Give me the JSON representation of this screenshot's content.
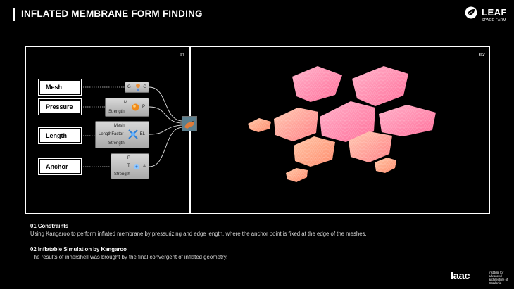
{
  "header": {
    "title": "INFLATED MEMBRANE FORM FINDING"
  },
  "logo": {
    "name": "LEAF",
    "sub": "SPACE FARM",
    "icon": "leaf-icon"
  },
  "panels": {
    "left_number": "01",
    "right_number": "02"
  },
  "grasshopper": {
    "params": [
      {
        "label": "Mesh"
      },
      {
        "label": "Pressure"
      },
      {
        "label": "Length"
      },
      {
        "label": "Anchor"
      }
    ],
    "components": {
      "mesh": {
        "in": "G",
        "out": "G"
      },
      "pressure": {
        "in1": "M",
        "in2": "Strength",
        "out": "P"
      },
      "length": {
        "in1": "Mesh",
        "in2": "LengthFactor",
        "in3": "Strength",
        "out": "EL"
      },
      "anchor": {
        "in1": "P",
        "in2": "T",
        "in3": "Strength",
        "out": "A"
      }
    },
    "solver_icon": "kangaroo-icon"
  },
  "captions": [
    {
      "heading": "01 Constraints",
      "body": "Using Kangaroo to perform inflated membrane by pressurizing and edge length, where the anchor point is fixed at the edge of the meshes."
    },
    {
      "heading": "02 Inflatable Simulation by Kangaroo",
      "body": "The results of innershell was brought by the final convergent of inflated geometry."
    }
  ],
  "footer": {
    "logo_text": "Iaac",
    "logo_sub": "Institute for advanced architecture of Catalonia"
  },
  "colors": {
    "background": "#000000",
    "mesh_pink": "#ff8fb1",
    "mesh_light": "#ffc2a8",
    "mesh_orange": "#ff9a7a"
  }
}
